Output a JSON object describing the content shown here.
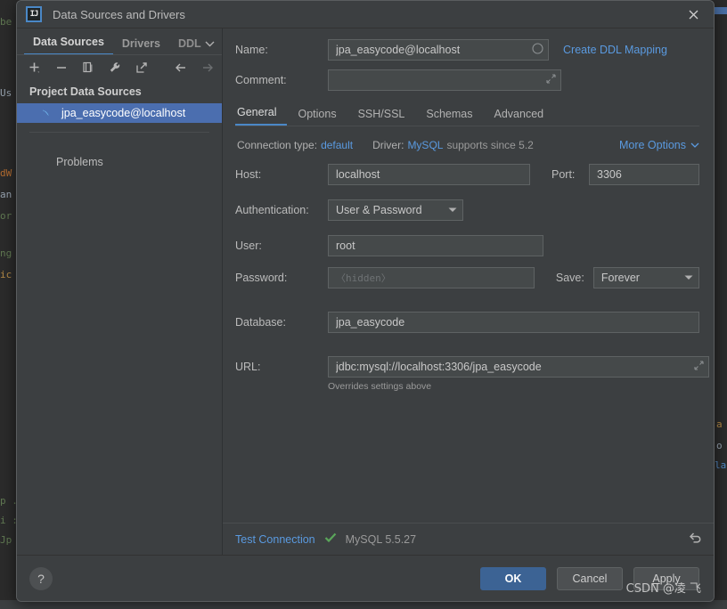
{
  "window": {
    "title": "Data Sources and Drivers",
    "logo_text": "IJ",
    "close_icon": "close-icon"
  },
  "sidebar": {
    "tabs": [
      {
        "label": "Data Sources",
        "active": true
      },
      {
        "label": "Drivers",
        "active": false
      },
      {
        "label": "DDL",
        "active": false,
        "clipped": true
      }
    ],
    "overflow_caret": "⌄",
    "toolbar": [
      {
        "name": "add-icon",
        "glyph": "+",
        "enabled": true,
        "has_dropdown": true
      },
      {
        "name": "remove-icon",
        "glyph": "−",
        "enabled": true
      },
      {
        "name": "copy-icon",
        "glyph": "❐",
        "enabled": true
      },
      {
        "name": "wrench-icon",
        "glyph": "ὒ7",
        "enabled": true
      },
      {
        "name": "share-icon",
        "glyph": "↗",
        "enabled": true
      },
      {
        "name": "back-arrow-icon",
        "glyph": "←",
        "enabled": true
      },
      {
        "name": "forward-arrow-icon",
        "glyph": "→",
        "enabled": false
      }
    ],
    "group_header": "Project Data Sources",
    "items": [
      {
        "label": "jpa_easycode@localhost",
        "icon": "mysql-dolphin-icon",
        "selected": true
      }
    ],
    "problems_label": "Problems"
  },
  "details": {
    "name_label": "Name:",
    "name_value": "jpa_easycode@localhost",
    "name_adorn_icon": "circle-icon",
    "create_ddl_mapping": "Create DDL Mapping",
    "comment_label": "Comment:",
    "comment_value": "",
    "comment_adorn_icon": "expand-icon",
    "tabs": [
      {
        "label": "General",
        "active": true
      },
      {
        "label": "Options",
        "active": false
      },
      {
        "label": "SSH/SSL",
        "active": false
      },
      {
        "label": "Schemas",
        "active": false
      },
      {
        "label": "Advanced",
        "active": false
      }
    ],
    "connection_type_label": "Connection type:",
    "connection_type_value": "default",
    "driver_label": "Driver:",
    "driver_value": "MySQL",
    "driver_support": "supports since 5.2",
    "more_options_label": "More Options",
    "more_options_caret": "⌄",
    "host_label": "Host:",
    "host_value": "localhost",
    "port_label": "Port:",
    "port_value": "3306",
    "auth_label": "Authentication:",
    "auth_value": "User & Password",
    "user_label": "User:",
    "user_value": "root",
    "password_label": "Password:",
    "password_placeholder": "〈hidden〉",
    "password_value": "",
    "save_label": "Save:",
    "save_value": "Forever",
    "database_label": "Database:",
    "database_value": "jpa_easycode",
    "url_label": "URL:",
    "url_value": "jdbc:mysql://localhost:3306/jpa_easycode",
    "url_adorn_icon": "expand-icon",
    "url_hint": "Overrides settings above"
  },
  "test_bar": {
    "test_connection_label": "Test Connection",
    "status_icon": "check-icon",
    "status_text": "MySQL 5.5.27",
    "revert_icon": "revert-icon"
  },
  "footer": {
    "help_icon": "help-icon",
    "help_glyph": "?",
    "ok_label": "OK",
    "cancel_label": "Cancel",
    "apply_mnemonic": "A",
    "apply_rest": "pply",
    "watermark": "CSDN @凌 飞"
  },
  "colors": {
    "dialog_bg": "#3c3f41",
    "field_bg": "#45494a",
    "accent_blue": "#4a88c7",
    "link_blue": "#5a9ae0",
    "selection_blue": "#4b6eaf",
    "primary_button": "#3c6394",
    "success_green": "#5aa55a",
    "ide_bg": "#2b2b2b"
  }
}
